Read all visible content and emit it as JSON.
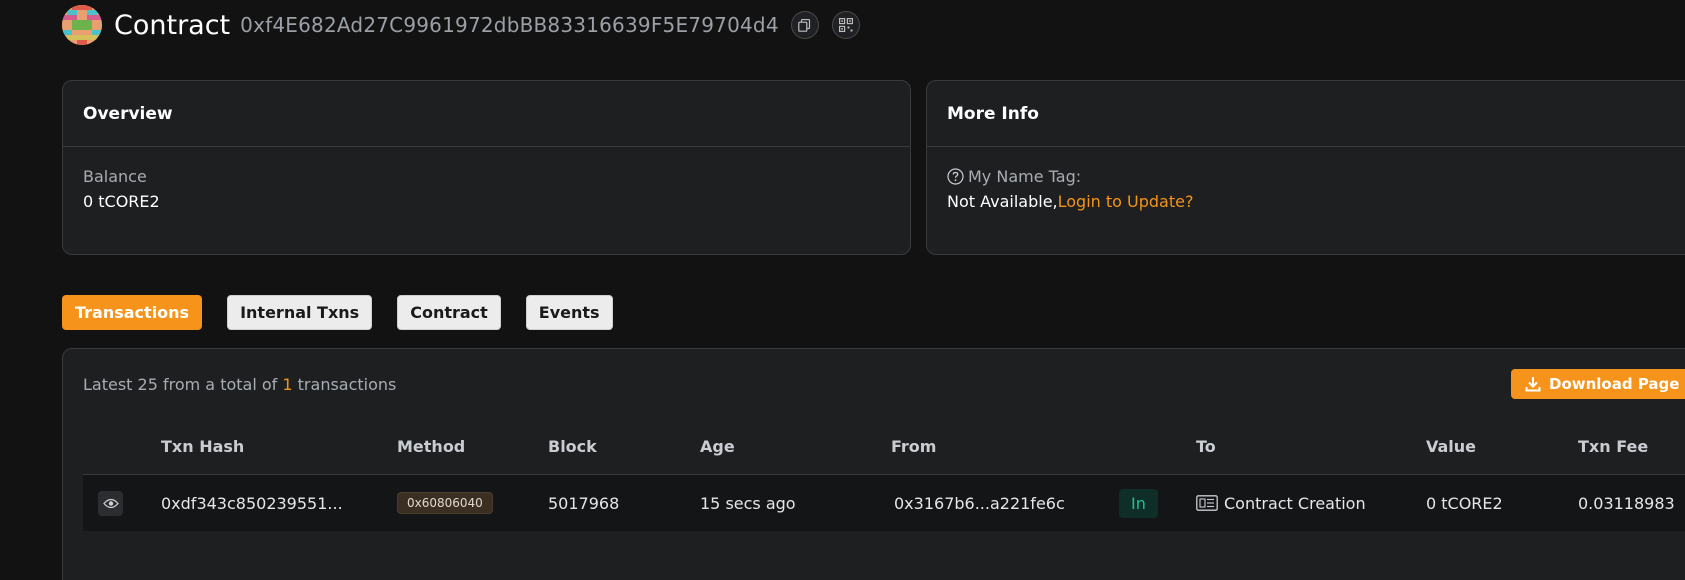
{
  "header": {
    "title": "Contract",
    "address": "0xf4E682Ad27C9961972dbBB83316639F5E79704d4"
  },
  "overview": {
    "title": "Overview",
    "balance_label": "Balance",
    "balance_value": "0 tCORE2"
  },
  "more_info": {
    "title": "More Info",
    "name_tag_label": "My Name Tag:",
    "name_tag_value": "Not Available,",
    "login_link": "Login to Update?"
  },
  "tabs": [
    {
      "label": "Transactions",
      "active": true
    },
    {
      "label": "Internal Txns",
      "active": false
    },
    {
      "label": "Contract",
      "active": false
    },
    {
      "label": "Events",
      "active": false
    }
  ],
  "transactions": {
    "summary_prefix": "Latest 25 from a total of",
    "summary_count": "1",
    "summary_suffix": "transactions",
    "download_label": "Download Page Data",
    "columns": [
      "Txn Hash",
      "Method",
      "Block",
      "Age",
      "From",
      "To",
      "Value",
      "Txn Fee"
    ],
    "rows": [
      {
        "txn_hash": "0xdf343c850239551...",
        "method": "0x60806040",
        "block": "5017968",
        "age": "15 secs ago",
        "from": "0x3167b6...a221fe6c",
        "direction": "In",
        "to": "Contract Creation",
        "value": "0 tCORE2",
        "txn_fee": "0.03118983"
      }
    ]
  },
  "colors": {
    "accent": "#f6931a",
    "background": "#121212",
    "card": "#1e1f21",
    "in_badge": "#1fbf9a"
  },
  "icons": [
    "contract-avatar-icon",
    "copy-icon",
    "qr-code-icon",
    "question-circle-icon",
    "download-icon",
    "eye-icon",
    "contract-document-icon"
  ]
}
